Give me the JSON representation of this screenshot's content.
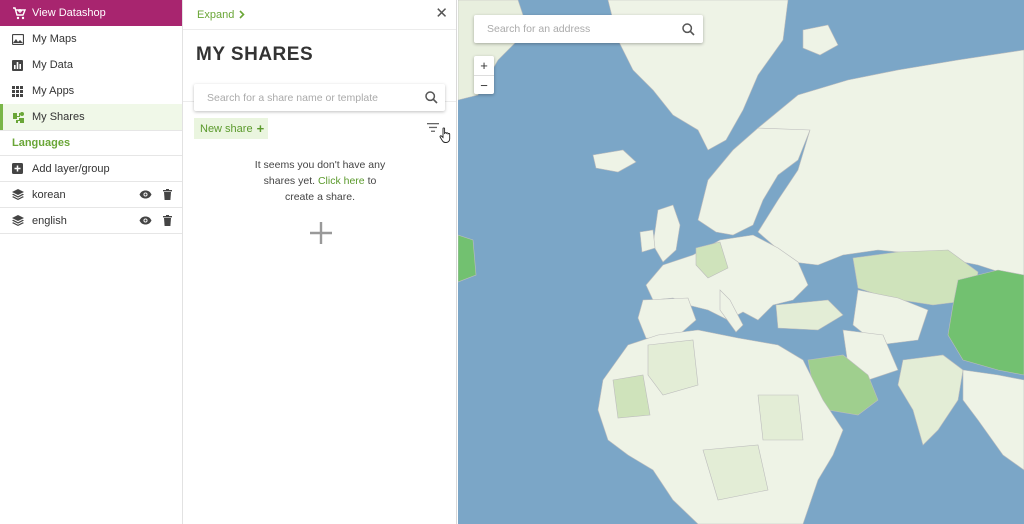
{
  "sidebar": {
    "datashop": {
      "label": "View Datashop",
      "icon": "cart-icon"
    },
    "nav": [
      {
        "label": "My Maps",
        "icon": "image-icon"
      },
      {
        "label": "My Data",
        "icon": "bar-chart-icon"
      },
      {
        "label": "My Apps",
        "icon": "grid-icon"
      },
      {
        "label": "My Shares",
        "icon": "puzzle-share-icon",
        "active": true
      }
    ],
    "languages_heading": "Languages",
    "add_layer_label": "Add layer/group",
    "layers": [
      {
        "label": "korean"
      },
      {
        "label": "english"
      }
    ]
  },
  "panel": {
    "expand_label": "Expand",
    "title": "MY SHARES",
    "search_placeholder": "Search for a share name or template",
    "new_share_label": "New share",
    "empty_line1": "It seems you don't have any",
    "empty_line2_prefix": "shares yet.",
    "empty_link": "Click here",
    "empty_line2_suffix": "to",
    "empty_line3": "create a share."
  },
  "map": {
    "search_placeholder": "Search for an address",
    "zoom_in": "+",
    "zoom_out": "−"
  },
  "colors": {
    "brand": "#a8256f",
    "accent": "#7ab648",
    "ocean": "#7ba6c7",
    "land_light": "#eef3e6",
    "land_mid": "#cfe3bb",
    "land_dark": "#72c170"
  }
}
